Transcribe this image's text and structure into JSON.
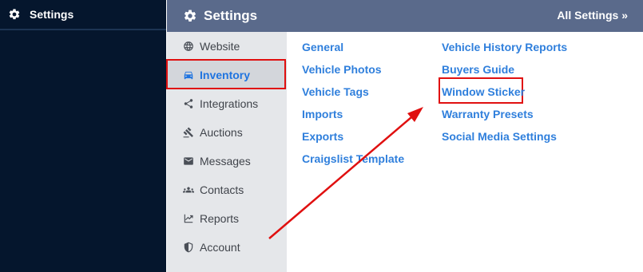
{
  "left_nav": {
    "title": "Settings",
    "icon": "gear-icon"
  },
  "topbar": {
    "title": "Settings",
    "icon": "gear-icon",
    "all_settings": "All Settings »"
  },
  "subnav": {
    "items": [
      {
        "label": "Website",
        "icon": "globe-icon"
      },
      {
        "label": "Inventory",
        "icon": "car-icon",
        "active": true
      },
      {
        "label": "Integrations",
        "icon": "share-icon"
      },
      {
        "label": "Auctions",
        "icon": "gavel-icon"
      },
      {
        "label": "Messages",
        "icon": "envelope-icon"
      },
      {
        "label": "Contacts",
        "icon": "users-icon"
      },
      {
        "label": "Reports",
        "icon": "chart-icon"
      },
      {
        "label": "Account",
        "icon": "shield-icon"
      }
    ]
  },
  "links": {
    "col1": [
      "General",
      "Vehicle Photos",
      "Vehicle Tags",
      "Imports",
      "Exports",
      "Craigslist Template"
    ],
    "col2": [
      "Vehicle History Reports",
      "Buyers Guide",
      "Window Sticker",
      "Warranty Presets",
      "Social Media Settings"
    ]
  },
  "annotation": {
    "color": "#e01010"
  }
}
